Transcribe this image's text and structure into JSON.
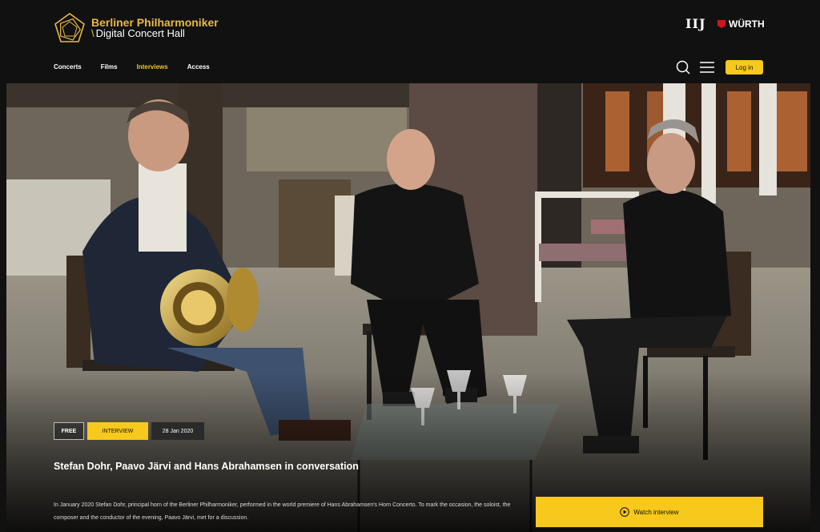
{
  "header": {
    "logo_line1": "Berliner Philharmoniker",
    "logo_line2": "Digital Concert Hall",
    "logo_slash": "\\",
    "sponsor_iij": "IIJ",
    "sponsor_wurth": "WÜRTH",
    "nav": [
      "Concerts",
      "Films",
      "Interviews",
      "Access"
    ],
    "active_nav": "Interviews",
    "login_label": "Log in"
  },
  "video": {
    "badge_free": "FREE",
    "badge_type": "INTERVIEW",
    "date": "28 Jan 2020",
    "title": "Stefan Dohr, Paavo Järvi and Hans Abrahamsen in conversation",
    "description": "In January 2020 Stefan Dohr, principal horn of the Berliner Philharmoniker, performed in the world premiere of Hans Abrahamsen's Horn Concerto. To mark the occasion, the soloist, the composer and the conductor of the evening, Paavo Järvi, met for a discussion.",
    "watch_label": "Watch interview"
  },
  "colors": {
    "accent": "#f7c91c",
    "nav_active": "#f2c230",
    "logo_gold": "#e9b949",
    "background": "#111111"
  },
  "icons": {
    "search": "search-icon",
    "menu": "menu-icon",
    "play": "play-icon"
  }
}
